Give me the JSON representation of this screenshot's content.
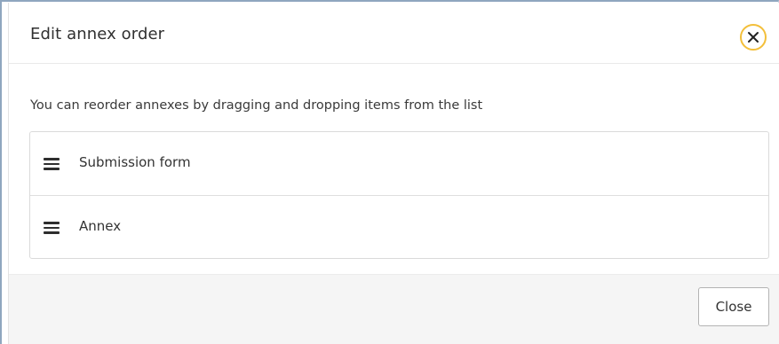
{
  "dialog": {
    "title": "Edit annex order",
    "close_icon": "close-icon",
    "instructions": "You can reorder annexes by dragging and dropping items from the list",
    "items": [
      {
        "label": "Submission form",
        "icon": "drag-handle-icon"
      },
      {
        "label": "Annex",
        "icon": "drag-handle-icon"
      }
    ],
    "close_button_label": "Close"
  },
  "colors": {
    "focus_ring": "#f3bf3a",
    "footer_background": "#f5f5f5",
    "text": "#333333"
  }
}
